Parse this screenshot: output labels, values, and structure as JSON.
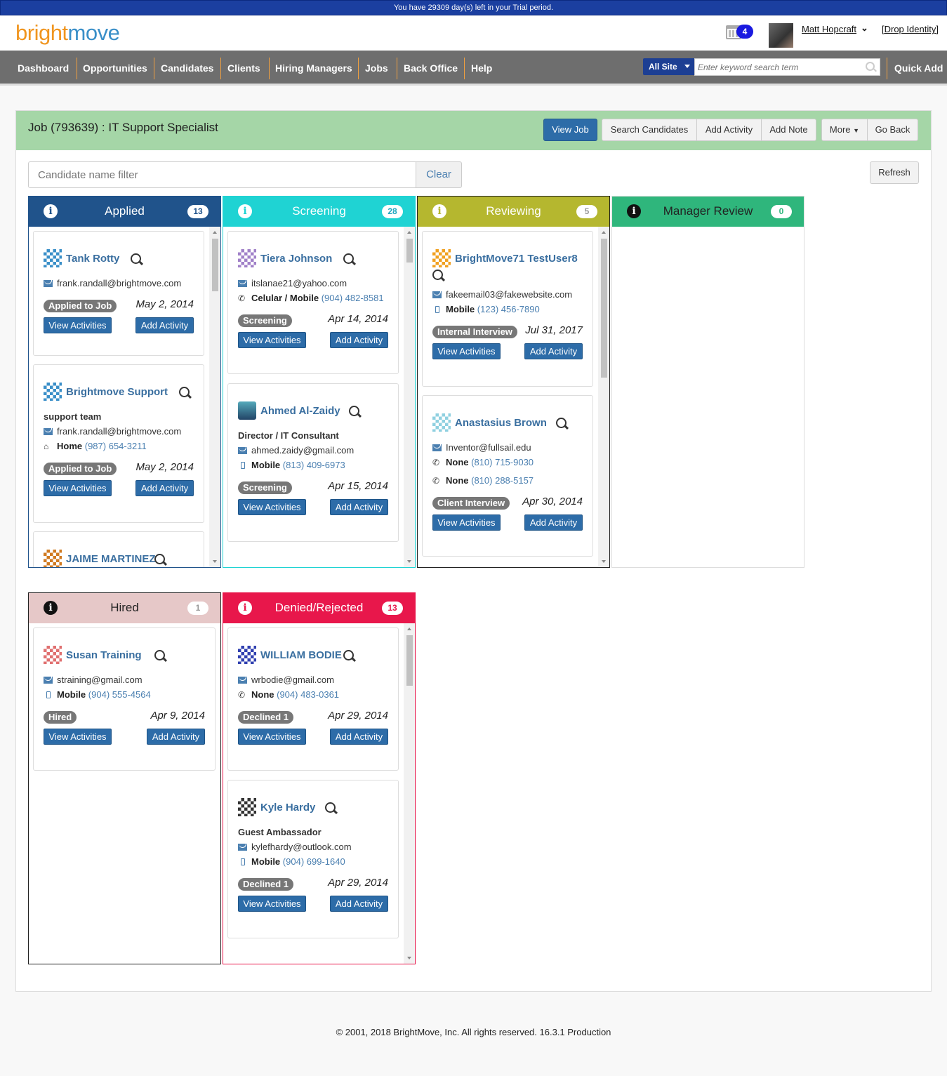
{
  "trial": "You have 29309 day(s) left in your Trial period.",
  "logo": {
    "part1": "bright",
    "part2": "move"
  },
  "header": {
    "notifications": "4",
    "user": "Matt Hopcraft",
    "drop": "[Drop Identity]"
  },
  "nav": [
    "Dashboard",
    "Opportunities",
    "Candidates",
    "Clients",
    "Hiring Managers",
    "Jobs",
    "Back Office",
    "Help"
  ],
  "search": {
    "scope": "All Site",
    "placeholder": "Enter keyword search term"
  },
  "quick_add": "Quick Add",
  "job": {
    "title": "Job (793639) : IT Support Specialist",
    "view": "View Job",
    "search": "Search Candidates",
    "add_activity": "Add Activity",
    "add_note": "Add Note",
    "more": "More",
    "back": "Go Back"
  },
  "filter": {
    "placeholder": "Candidate name filter",
    "clear": "Clear",
    "refresh": "Refresh"
  },
  "cols": [
    {
      "title": "Applied",
      "count": "13",
      "color": "#20538b",
      "cards": [
        {
          "name": "Tank Rotty",
          "email": "frank.randall@brightmove.com",
          "status": "Applied to Job",
          "date": "May 2, 2014"
        },
        {
          "name": "Brightmove Support",
          "title": "support team",
          "email": "frank.randall@brightmove.com",
          "ptype": "Home",
          "phone": "(987) 654-3211",
          "status": "Applied to Job",
          "date": "May 2, 2014"
        },
        {
          "name": "JAIME MARTINEZ"
        }
      ]
    },
    {
      "title": "Screening",
      "count": "28",
      "color": "#1fd3d3",
      "cards": [
        {
          "name": "Tiera Johnson",
          "email": "itslanae21@yahoo.com",
          "ptype": "Celular / Mobile",
          "phone": "(904) 482-8581",
          "status": "Screening",
          "date": "Apr 14, 2014"
        },
        {
          "name": "Ahmed Al-Zaidy",
          "title": "Director / IT Consultant",
          "email": "ahmed.zaidy@gmail.com",
          "ptype": "Mobile",
          "phone": "(813) 409-6973",
          "status": "Screening",
          "date": "Apr 15, 2014"
        }
      ]
    },
    {
      "title": "Reviewing",
      "count": "5",
      "color": "#b5b72f",
      "cards": [
        {
          "name": "BrightMove71 TestUser8",
          "email": "fakeemail03@fakewebsite.com",
          "ptype": "Mobile",
          "phone": "(123) 456-7890",
          "status": "Internal Interview",
          "date": "Jul 31, 2017"
        },
        {
          "name": "Anastasius Brown",
          "email": "Inventor@fullsail.edu",
          "ptype": "None",
          "phone": "(810) 715-9030",
          "ptype2": "None",
          "phone2": "(810) 288-5157",
          "status": "Client Interview",
          "date": "Apr 30, 2014"
        }
      ]
    },
    {
      "title": "Manager Review",
      "count": "0",
      "color": "#2fb67c",
      "cards": []
    },
    {
      "title": "Hired",
      "count": "1",
      "color": "#e6c8c8",
      "cards": [
        {
          "name": "Susan Training",
          "email": "straining@gmail.com",
          "ptype": "Mobile",
          "phone": "(904) 555-4564",
          "status": "Hired",
          "date": "Apr 9, 2014"
        }
      ]
    },
    {
      "title": "Denied/Rejected",
      "count": "13",
      "color": "#e8174b",
      "cards": [
        {
          "name": "WILLIAM BODIE",
          "email": "wrbodie@gmail.com",
          "ptype": "None",
          "phone": "(904) 483-0361",
          "status": "Declined 1",
          "date": "Apr 29, 2014"
        },
        {
          "name": "Kyle Hardy",
          "title": "Guest Ambassador",
          "email": "kylefhardy@outlook.com",
          "ptype": "Mobile",
          "phone": "(904) 699-1640",
          "status": "Declined 1",
          "date": "Apr 29, 2014"
        }
      ]
    }
  ],
  "actions": {
    "view": "View Activities",
    "add": "Add Activity"
  },
  "footer": "© 2001, 2018 BrightMove, Inc. All rights reserved. 16.3.1 Production"
}
